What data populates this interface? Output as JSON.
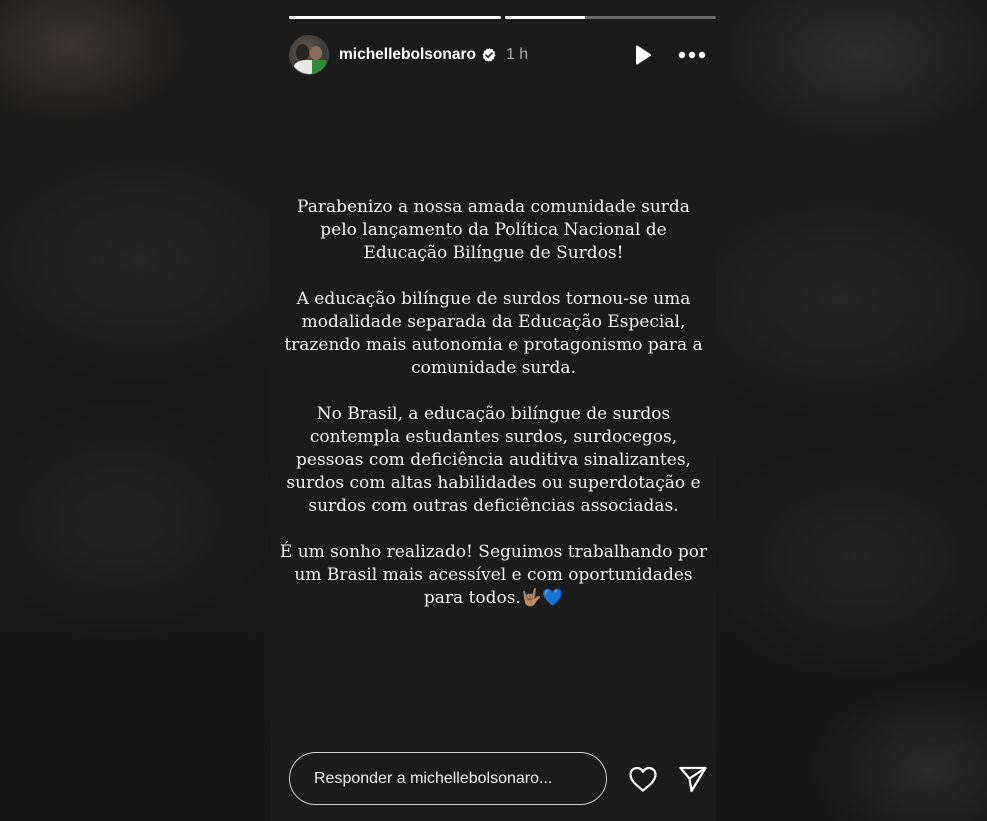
{
  "story": {
    "progress": [
      1.0,
      0.38
    ],
    "author": {
      "username": "michellebolsonaro",
      "verified": true,
      "time_ago": "1 h"
    },
    "paragraphs": [
      "Parabenizo a nossa amada comunidade surda\npelo lançamento da Política Nacional de\nEducação Bilíngue de Surdos!",
      "A educação bilíngue de surdos tornou-se uma\nmodalidade separada da Educação Especial,\ntrazendo mais autonomia e protagonismo para a\ncomunidade surda.",
      "No Brasil, a educação bilíngue de surdos\ncontempla estudantes surdos, surdocegos,\npessoas com deficiência auditiva sinalizantes,\nsurdos com altas habilidades ou superdotação e\nsurdos com outras deficiências associadas.",
      "É um sonho realizado! Seguimos trabalhando por\num Brasil mais acessível e com oportunidades\npara todos.🤟🏽💙"
    ]
  },
  "reply": {
    "placeholder": "Responder a michellebolsonaro..."
  },
  "icons": {
    "play": "play-icon",
    "more": "more-icon",
    "like": "heart-icon",
    "share": "send-icon",
    "verified": "verified-badge-icon"
  },
  "colors": {
    "verified": "#ffffff",
    "text": "#f2f2f2",
    "muted": "#a8a8a8"
  }
}
